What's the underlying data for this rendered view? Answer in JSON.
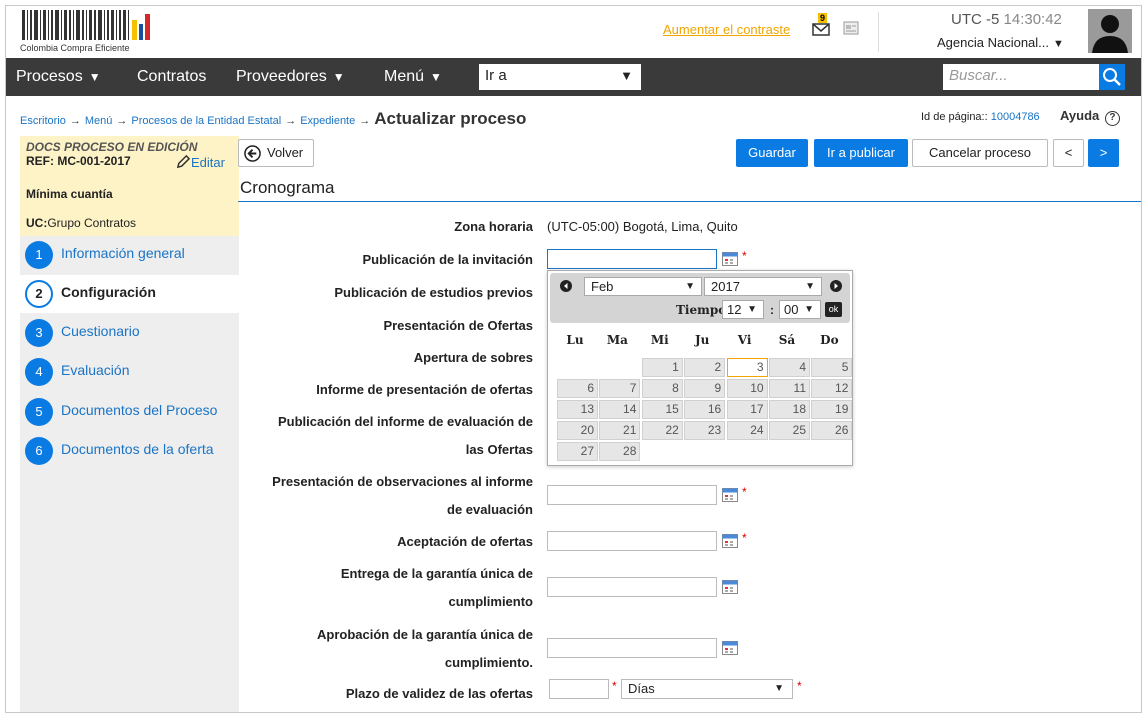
{
  "header": {
    "logo_text": "Colombia Compra Eficiente",
    "contrast_link": "Aumentar el contraste",
    "notifications_count": "9",
    "timezone": "UTC -5",
    "clock": "14:30:42",
    "agency": "Agencia Nacional...",
    "colors": {
      "accent": "#0a7be3",
      "link_orange": "#f0a500",
      "navbar": "#3a3a3a"
    }
  },
  "navbar": {
    "procesos": "Procesos",
    "contratos": "Contratos",
    "proveedores": "Proveedores",
    "menu": "Menú",
    "goto_value": "Ir a",
    "search_placeholder": "Buscar..."
  },
  "breadcrumb": {
    "items": [
      "Escritorio",
      "Menú",
      "Procesos de la Entidad Estatal",
      "Expediente"
    ],
    "current": "Actualizar proceso",
    "page_id_label": "Id de página::",
    "page_id": "10004786",
    "help": "Ayuda"
  },
  "sidebar": {
    "status": "DOCS PROCESO EN EDICIÓN",
    "ref": "REF: MC-001-2017",
    "edit": "Editar",
    "modality": "Mínima cuantía",
    "uc_label": "UC:",
    "uc_value": "Grupo Contratos",
    "steps": [
      {
        "num": "1",
        "label": "Información general"
      },
      {
        "num": "2",
        "label": "Configuración"
      },
      {
        "num": "3",
        "label": "Cuestionario"
      },
      {
        "num": "4",
        "label": "Evaluación"
      },
      {
        "num": "5",
        "label": "Documentos del Proceso"
      },
      {
        "num": "6",
        "label": "Documentos de la oferta"
      }
    ]
  },
  "toolbar": {
    "back": "Volver",
    "save": "Guardar",
    "publish": "Ir a publicar",
    "cancel": "Cancelar proceso",
    "prev": "<",
    "next": ">"
  },
  "section": {
    "title": "Cronograma"
  },
  "form": {
    "tz_label": "Zona horaria",
    "tz_value": "(UTC-05:00) Bogotá, Lima, Quito",
    "f1": "Publicación de la invitación",
    "f2": "Publicación de estudios previos",
    "f3": "Presentación de Ofertas",
    "f4": "Apertura de sobres",
    "f5": "Informe de presentación de ofertas",
    "f6a": "Publicación del informe de evaluación de",
    "f6b": "las Ofertas",
    "f7a": "Presentación de observaciones al informe",
    "f7b": "de evaluación",
    "f8": "Aceptación de ofertas",
    "f9a": "Entrega de la garantía única de",
    "f9b": "cumplimiento",
    "f10a": "Aprobación de la garantía única de",
    "f10b": "cumplimiento.",
    "f11": "Plazo de validez de las ofertas",
    "days_option": "Días",
    "required_mark": "*"
  },
  "datepicker": {
    "month": "Feb",
    "year": "2017",
    "time_label": "Tiempo:",
    "hour": "12",
    "minute": "00",
    "ok": "ok",
    "weekdays": [
      "Lu",
      "Ma",
      "Mi",
      "Ju",
      "Vi",
      "Sá",
      "Do"
    ],
    "days": [
      "1",
      "2",
      "3",
      "4",
      "5",
      "6",
      "7",
      "8",
      "9",
      "10",
      "11",
      "12",
      "13",
      "14",
      "15",
      "16",
      "17",
      "18",
      "19",
      "20",
      "21",
      "22",
      "23",
      "24",
      "25",
      "26",
      "27",
      "28"
    ],
    "today": "3"
  }
}
